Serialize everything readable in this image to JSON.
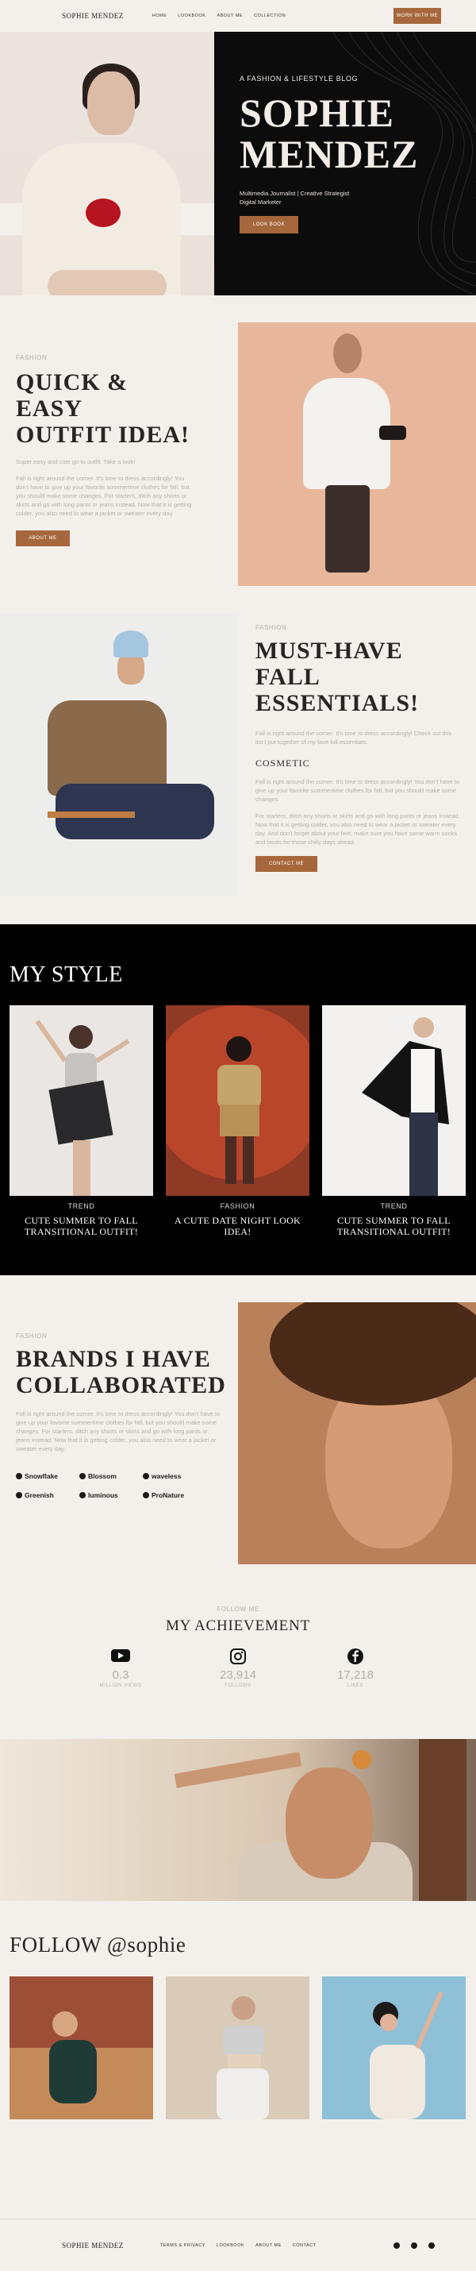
{
  "nav": {
    "logo": "SOPHIE MENDEZ",
    "links": [
      "HOME",
      "LOOKBOOK",
      "ABOUT ME",
      "COLLECTION"
    ],
    "cta": "WORK WITH ME"
  },
  "hero": {
    "eyebrow": "A FASHION & LIFESTYLE BLOG",
    "name_line1": "SOPHIE",
    "name_line2": "MENDEZ",
    "role_line1": "Multimedia Journalist | Creative Strategist",
    "role_line2": "Digital Marketer",
    "button": "LOOK BOOK"
  },
  "outfit": {
    "eyebrow": "FASHION",
    "title_line1": "QUICK & EASY",
    "title_line2": "OUTFIT IDEA!",
    "lead": "Super easy and cute go-to outfit. Take a look!",
    "paragraph": "Fall is right around the corner. It's time to dress accordingly! You don't have to give up your favorite summertime clothes for fall, but you should make some changes. For starters, ditch any shorts or skirts and go with long pants or jeans instead. Now that it is getting colder, you also need to wear a jacket or sweater every day.",
    "button": "ABOUT ME"
  },
  "essentials": {
    "eyebrow": "FASHION",
    "title_line1": "MUST-HAVE FALL",
    "title_line2": "ESSENTIALS!",
    "para1": "Fall is right around the corner. It's time to dress accordingly! Check out this list I put together of my fave fall essentials.",
    "subheading": "COSMETIC",
    "para2": "Fall is right around the corner. It's time to dress accordingly! You don't have to give up your favorite summertime clothes for fall, but you should make some changes.",
    "para3": "For starters, ditch any shorts or skirts and go with long pants or jeans instead. Now that it is getting colder, you also need to wear a jacket or sweater every day. And don't forget about your feet; make sure you have some warm socks and boots for those chilly days ahead.",
    "button": "CONTACT ME"
  },
  "mystyle": {
    "title": "MY STYLE",
    "cards": [
      {
        "tag": "TREND",
        "title_line1": "CUTE SUMMER TO FALL",
        "title_line2": "TRANSITIONAL OUTFIT!"
      },
      {
        "tag": "FASHION",
        "title_line1": "A CUTE DATE NIGHT LOOK",
        "title_line2": "IDEA!"
      },
      {
        "tag": "TREND",
        "title_line1": "CUTE SUMMER TO FALL",
        "title_line2": "TRANSITIONAL OUTFIT!"
      }
    ]
  },
  "brands": {
    "eyebrow": "FASHION",
    "title_line1": "BRANDS I HAVE",
    "title_line2": "COLLABORATED",
    "paragraph": "Fall is right around the corner. It's time to dress accordingly! You don't have to give up your favorite summertime clothes for fall, but you should make some changes. For starters, ditch any shorts or skirts and go with long pants or jeans instead. Now that it is getting colder, you also need to wear a jacket or sweater every day.",
    "logos": [
      "Snowflake",
      "Blossom",
      "waveless",
      "Greenish",
      "luminous",
      "ProNature"
    ]
  },
  "achievement": {
    "eyebrow": "FOLLOW ME",
    "title": "MY ACHIEVEMENT",
    "stats": [
      {
        "icon": "youtube-icon",
        "value": "0.3",
        "label": "MILLION VIEWS"
      },
      {
        "icon": "instagram-icon",
        "value": "23,914",
        "label": "FOLLOWS"
      },
      {
        "icon": "facebook-icon",
        "value": "17,218",
        "label": "LIKES"
      }
    ]
  },
  "follow": {
    "title": "FOLLOW @sophie"
  },
  "footer": {
    "logo": "SOPHIE MENDEZ",
    "links": [
      "TERMS & PRIVACY",
      "LOOKBOOK",
      "ABOUT ME",
      "CONTACT"
    ],
    "socials": [
      "facebook-icon",
      "pinterest-icon",
      "instagram-icon"
    ]
  },
  "colors": {
    "accent": "#a7673c",
    "background": "#f3f0ec",
    "dark": "#000000"
  }
}
